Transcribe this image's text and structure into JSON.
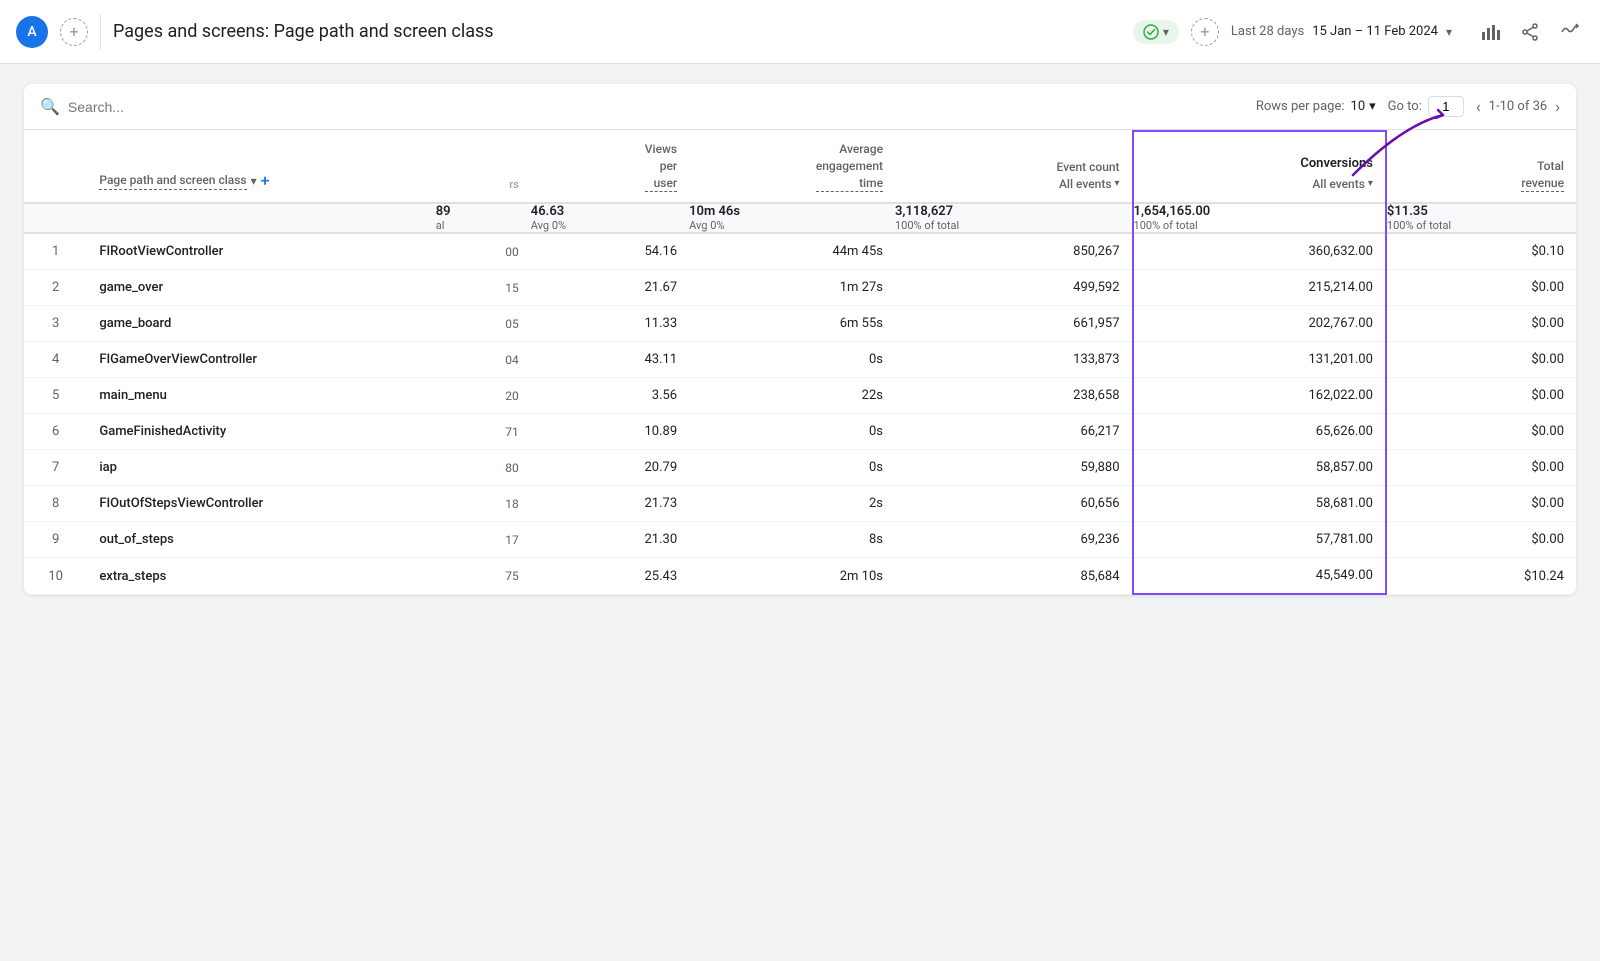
{
  "topbar": {
    "avatar_letter": "A",
    "page_title": "Pages and screens: Page path and screen class",
    "status_label": "",
    "date_label": "Last 28 days",
    "date_range": "15 Jan – 11 Feb 2024"
  },
  "toolbar": {
    "search_placeholder": "Search...",
    "rows_per_page_label": "Rows per page:",
    "rows_per_page_value": "10",
    "goto_label": "Go to:",
    "goto_value": "1",
    "pagination_text": "1-10 of 36"
  },
  "table": {
    "headers": {
      "page": "Page path and screen class",
      "views_per_user": "Views per user",
      "avg_engagement": "Average engagement time",
      "event_count": "Event count",
      "event_count_sub": "All events",
      "conversions": "Conversions",
      "conversions_sub": "All events",
      "total_revenue": "Total revenue"
    },
    "summary": {
      "views_per_user": "46.63",
      "views_per_user_sub": "Avg 0%",
      "avg_engagement": "10m 46s",
      "avg_engagement_sub": "Avg 0%",
      "event_count": "3,118,627",
      "event_count_sub": "100% of total",
      "conversions": "1,654,165.00",
      "conversions_sub": "100% of total",
      "total_revenue": "$11.35",
      "total_revenue_sub": "100% of total",
      "num_col": "89",
      "num_col_sub": "al"
    },
    "rows": [
      {
        "rank": 1,
        "page": "FIRootViewController",
        "num": "00",
        "views_per_user": "54.16",
        "avg_engagement": "44m 45s",
        "event_count": "850,267",
        "conversions": "360,632.00",
        "total_revenue": "$0.10"
      },
      {
        "rank": 2,
        "page": "game_over",
        "num": "15",
        "views_per_user": "21.67",
        "avg_engagement": "1m 27s",
        "event_count": "499,592",
        "conversions": "215,214.00",
        "total_revenue": "$0.00"
      },
      {
        "rank": 3,
        "page": "game_board",
        "num": "05",
        "views_per_user": "11.33",
        "avg_engagement": "6m 55s",
        "event_count": "661,957",
        "conversions": "202,767.00",
        "total_revenue": "$0.00"
      },
      {
        "rank": 4,
        "page": "FIGameOverViewController",
        "num": "04",
        "views_per_user": "43.11",
        "avg_engagement": "0s",
        "event_count": "133,873",
        "conversions": "131,201.00",
        "total_revenue": "$0.00"
      },
      {
        "rank": 5,
        "page": "main_menu",
        "num": "20",
        "views_per_user": "3.56",
        "avg_engagement": "22s",
        "event_count": "238,658",
        "conversions": "162,022.00",
        "total_revenue": "$0.00"
      },
      {
        "rank": 6,
        "page": "GameFinishedActivity",
        "num": "71",
        "views_per_user": "10.89",
        "avg_engagement": "0s",
        "event_count": "66,217",
        "conversions": "65,626.00",
        "total_revenue": "$0.00"
      },
      {
        "rank": 7,
        "page": "iap",
        "num": "80",
        "views_per_user": "20.79",
        "avg_engagement": "0s",
        "event_count": "59,880",
        "conversions": "58,857.00",
        "total_revenue": "$0.00"
      },
      {
        "rank": 8,
        "page": "FIOutOfStepsViewController",
        "num": "18",
        "views_per_user": "21.73",
        "avg_engagement": "2s",
        "event_count": "60,656",
        "conversions": "58,681.00",
        "total_revenue": "$0.00"
      },
      {
        "rank": 9,
        "page": "out_of_steps",
        "num": "17",
        "views_per_user": "21.30",
        "avg_engagement": "8s",
        "event_count": "69,236",
        "conversions": "57,781.00",
        "total_revenue": "$0.00"
      },
      {
        "rank": 10,
        "page": "extra_steps",
        "num": "75",
        "views_per_user": "25.43",
        "avg_engagement": "2m 10s",
        "event_count": "85,684",
        "conversions": "45,549.00",
        "total_revenue": "$10.24"
      }
    ]
  }
}
